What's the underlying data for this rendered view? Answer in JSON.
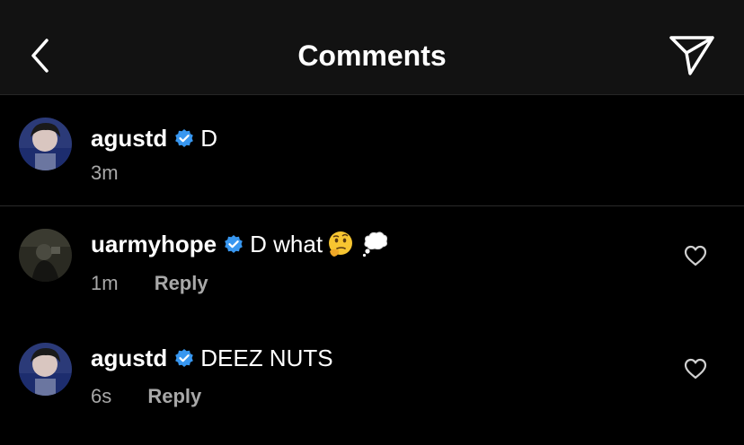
{
  "header": {
    "back_icon": "chevron-left-icon",
    "title": "Comments",
    "share_icon": "paper-plane-icon"
  },
  "post": {
    "username": "agustd",
    "verified": true,
    "text": "D",
    "time": "3m"
  },
  "comments": [
    {
      "username": "uarmyhope",
      "verified": true,
      "text": "D what",
      "emojis": [
        "thinking-face-icon",
        "thought-balloon-icon"
      ],
      "time": "1m",
      "reply_label": "Reply",
      "like_icon": "heart-outline-icon"
    },
    {
      "username": "agustd",
      "verified": true,
      "text": "DEEZ NUTS",
      "time": "6s",
      "reply_label": "Reply",
      "like_icon": "heart-outline-icon"
    }
  ],
  "colors": {
    "background": "#000000",
    "header_background": "#121212",
    "text_primary": "#ffffff",
    "text_secondary": "#a8a8a8",
    "verified_badge": "#3897f0",
    "divider": "#262626"
  }
}
